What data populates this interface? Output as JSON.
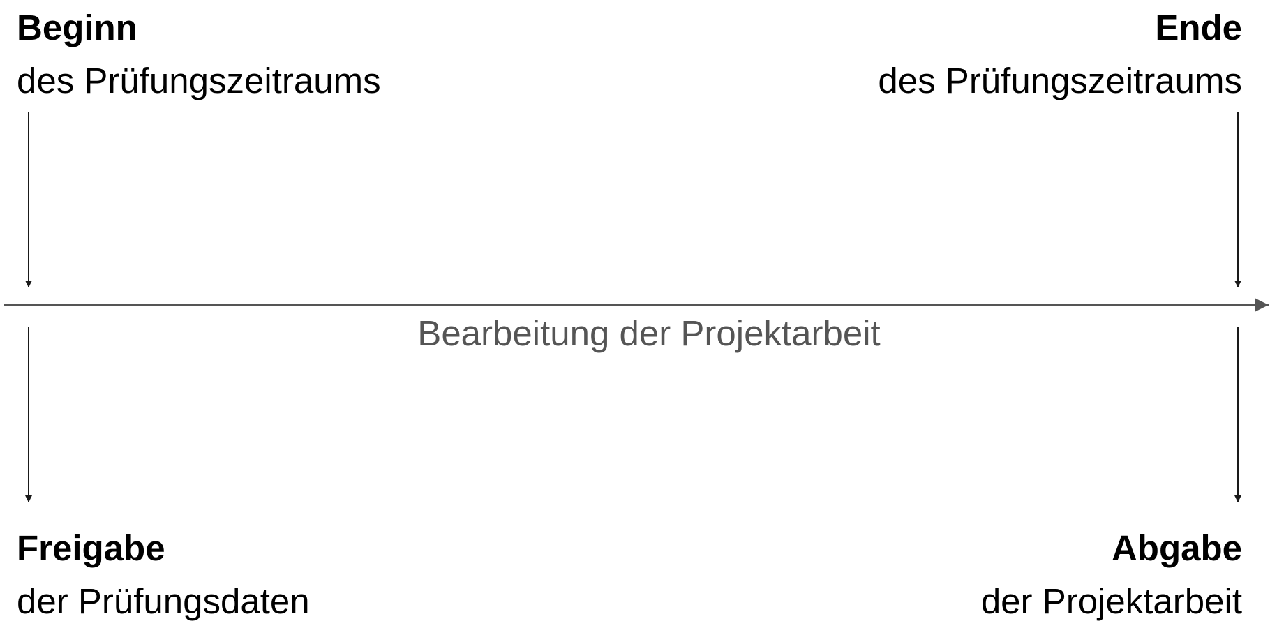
{
  "milestones": {
    "top_left": {
      "title": "Beginn",
      "subtitle": "des Prüfungszeitraums"
    },
    "top_right": {
      "title": "Ende",
      "subtitle": "des Prüfungszeitraums"
    },
    "bottom_left": {
      "title": "Freigabe",
      "subtitle": "der Prüfungsdaten"
    },
    "bottom_right": {
      "title": "Abgabe",
      "subtitle": "der Projektarbeit"
    }
  },
  "timeline": {
    "caption": "Bearbeitung der Projektarbeit"
  },
  "colors": {
    "text": "#000000",
    "timeline": "#555555",
    "caption": "#555555",
    "arrows": "#1a1a1a"
  }
}
